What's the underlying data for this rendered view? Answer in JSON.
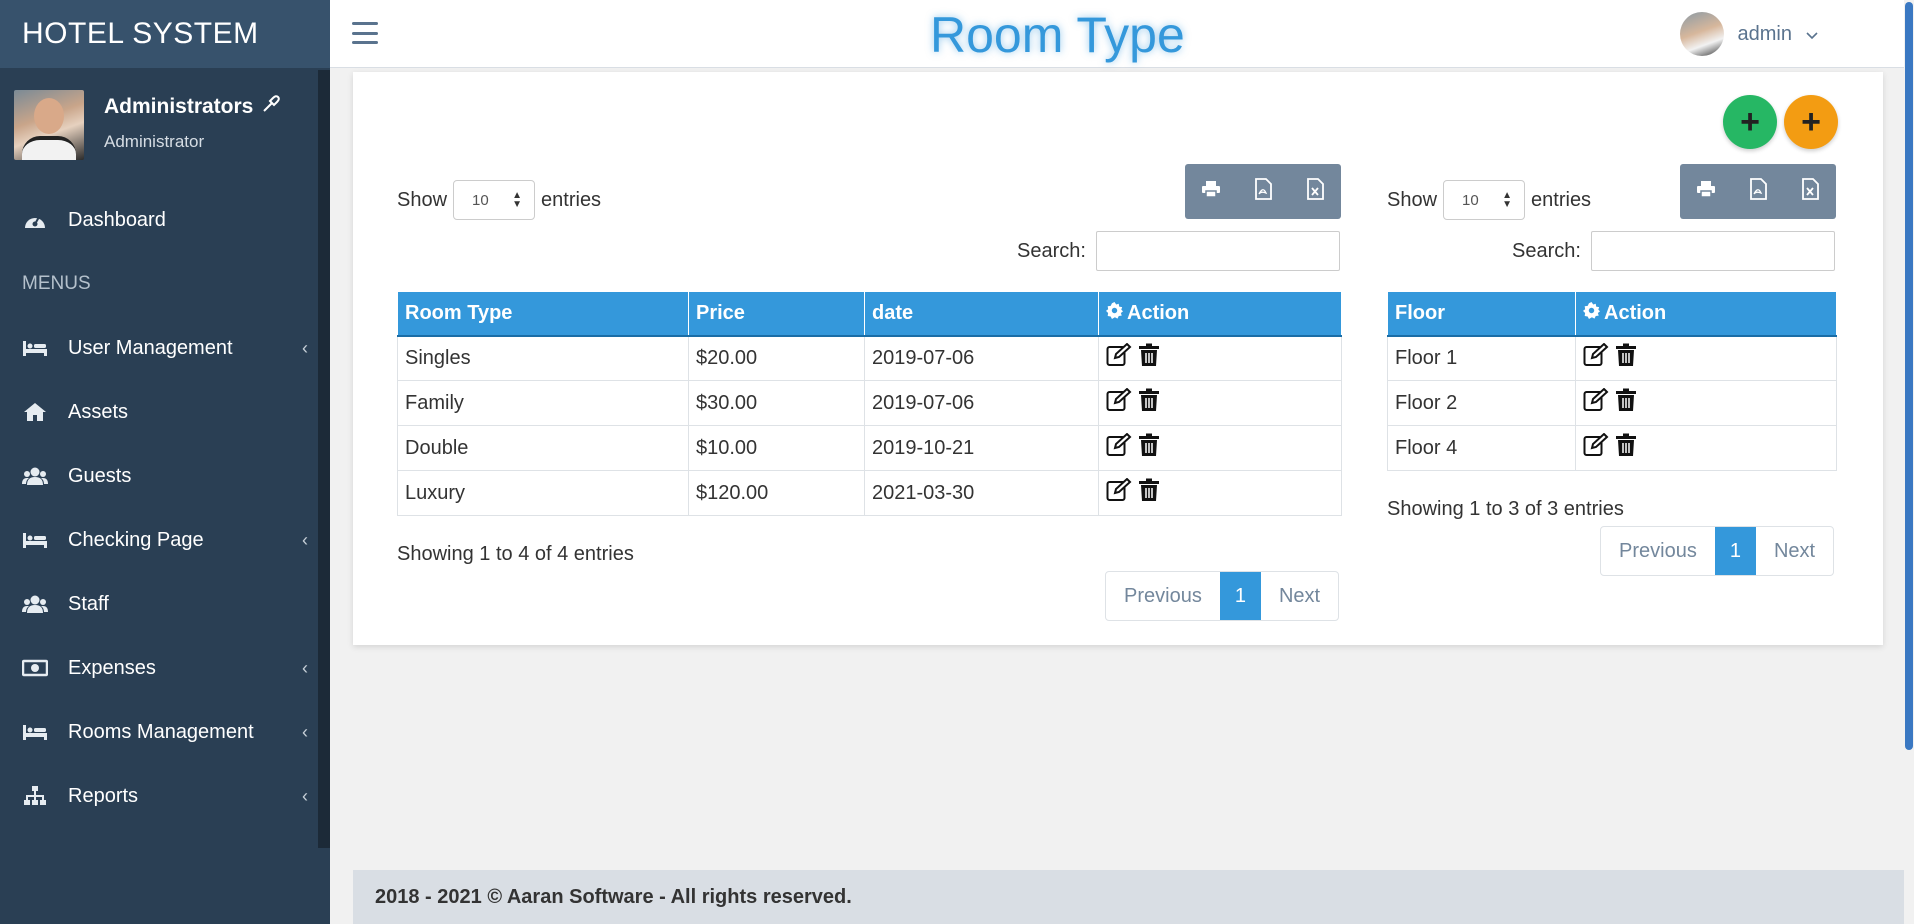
{
  "app": {
    "brand": "HOTEL SYSTEM",
    "page_title": "Room Type"
  },
  "profile": {
    "name": "Administrators",
    "role": "Administrator"
  },
  "user_menu": {
    "name": "admin"
  },
  "sidebar": {
    "dashboard": "Dashboard",
    "menus_header": "MENUS",
    "items": [
      {
        "label": "User Management",
        "icon": "bed-icon",
        "has_submenu": true
      },
      {
        "label": "Assets",
        "icon": "home-icon",
        "has_submenu": false
      },
      {
        "label": "Guests",
        "icon": "users-icon",
        "has_submenu": false
      },
      {
        "label": "Checking Page",
        "icon": "bed-icon",
        "has_submenu": true
      },
      {
        "label": "Staff",
        "icon": "users-icon",
        "has_submenu": false
      },
      {
        "label": "Expenses",
        "icon": "money-icon",
        "has_submenu": true
      },
      {
        "label": "Rooms Management",
        "icon": "bed-icon",
        "has_submenu": true
      },
      {
        "label": "Reports",
        "icon": "sitemap-icon",
        "has_submenu": true
      }
    ]
  },
  "left_table": {
    "show_label": "Show",
    "entries_label": "entries",
    "page_length": "10",
    "search_label": "Search:",
    "columns": [
      "Room Type",
      "Price",
      "date",
      "Action"
    ],
    "rows": [
      [
        "Singles",
        "$20.00",
        "2019-07-06"
      ],
      [
        "Family",
        "$30.00",
        "2019-07-06"
      ],
      [
        "Double",
        "$10.00",
        "2019-10-21"
      ],
      [
        "Luxury",
        "$120.00",
        "2021-03-30"
      ]
    ],
    "info": "Showing 1 to 4 of 4 entries",
    "pagination": {
      "previous": "Previous",
      "current": "1",
      "next": "Next"
    }
  },
  "right_table": {
    "show_label": "Show",
    "entries_label": "entries",
    "page_length": "10",
    "search_label": "Search:",
    "columns": [
      "Floor",
      "Action"
    ],
    "rows": [
      [
        "Floor 1"
      ],
      [
        "Floor 2"
      ],
      [
        "Floor 4"
      ]
    ],
    "info": "Showing 1 to 3 of 3 entries",
    "pagination": {
      "previous": "Previous",
      "current": "1",
      "next": "Next"
    }
  },
  "buttons": {
    "add_room_type": "+",
    "add_floor": "+"
  },
  "footer": {
    "text": "2018 - 2021 © Aaran Software - All rights reserved."
  },
  "colors": {
    "sidebar": "#2a3f54",
    "primary": "#3498db",
    "green": "#26b764",
    "orange": "#f39c12",
    "export": "#73879c"
  }
}
